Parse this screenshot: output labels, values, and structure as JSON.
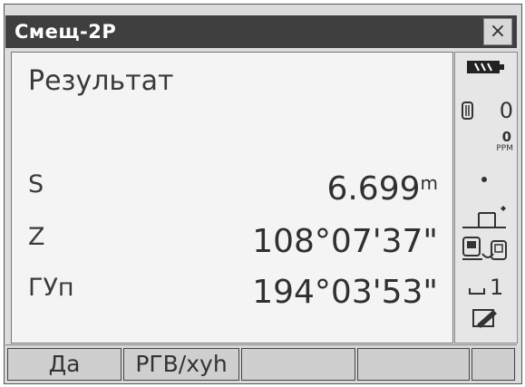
{
  "window": {
    "title": "Смещ-2P",
    "close_label": "×"
  },
  "main": {
    "heading": "Результат",
    "rows": [
      {
        "label": "S",
        "value": "6.699",
        "unit": "m"
      },
      {
        "label": "Z",
        "value": "108°07'37\"",
        "unit": ""
      },
      {
        "label": "ГУп",
        "value": "194°03'53\"",
        "unit": ""
      }
    ]
  },
  "status": {
    "battery_icon": "battery-icon",
    "target_value": "0",
    "ppm_value": "0",
    "ppm_label": "PPM",
    "laser_dot_icon": "dot-icon",
    "tilt_icon": "tilt-icon",
    "instrument_icon": "instrument-icon",
    "counter_value": "1",
    "edit_icon": "edit-icon"
  },
  "softkeys": [
    "Да",
    "РГВ/xyh",
    "",
    "",
    ""
  ]
}
